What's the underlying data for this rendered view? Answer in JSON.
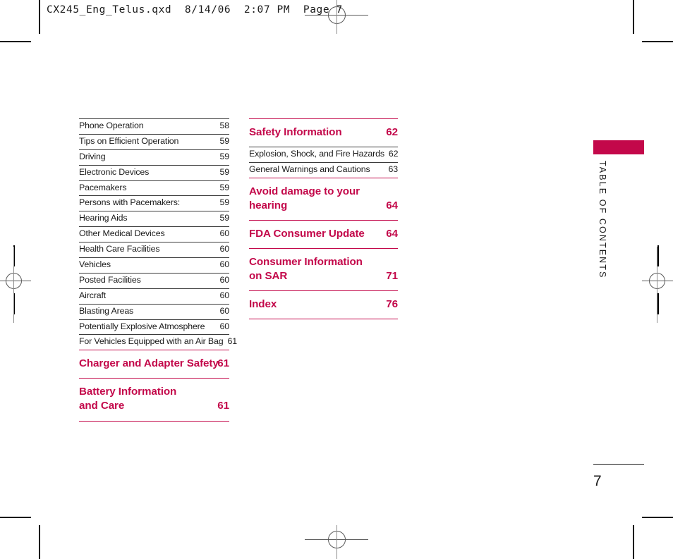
{
  "meta": {
    "slug": "CX245_Eng_Telus.qxd  8/14/06  2:07 PM  Page 7",
    "accent_color": "#c3084a",
    "rule_color": "#3b3b3b",
    "text_color": "#1a1a1a",
    "folio": "7",
    "side_tab_label": "TABLE OF CONTENTS"
  },
  "toc": {
    "left_column": [
      {
        "label": "Phone Operation",
        "page": "58",
        "kind": "sub"
      },
      {
        "label": "Tips on Efficient Operation",
        "page": "59",
        "kind": "sub"
      },
      {
        "label": "Driving",
        "page": "59",
        "kind": "sub"
      },
      {
        "label": "Electronic Devices",
        "page": "59",
        "kind": "sub"
      },
      {
        "label": "Pacemakers",
        "page": "59",
        "kind": "sub"
      },
      {
        "label": "Persons with Pacemakers:",
        "page": "59",
        "kind": "sub"
      },
      {
        "label": "Hearing Aids",
        "page": "59",
        "kind": "sub"
      },
      {
        "label": "Other Medical Devices",
        "page": "60",
        "kind": "sub"
      },
      {
        "label": "Health Care Facilities",
        "page": "60",
        "kind": "sub"
      },
      {
        "label": "Vehicles",
        "page": "60",
        "kind": "sub"
      },
      {
        "label": "Posted Facilities",
        "page": "60",
        "kind": "sub"
      },
      {
        "label": "Aircraft",
        "page": "60",
        "kind": "sub"
      },
      {
        "label": "Blasting Areas",
        "page": "60",
        "kind": "sub"
      },
      {
        "label": "Potentially Explosive Atmosphere",
        "page": "60",
        "kind": "sub"
      },
      {
        "label": "For Vehicles Equipped with an Air Bag",
        "page": "61",
        "kind": "sub"
      },
      {
        "label": "Charger and Adapter Safety",
        "page": "61",
        "kind": "head",
        "lines": 1
      },
      {
        "label": "Battery Information and Care",
        "page": "61",
        "kind": "head",
        "lines": 2
      }
    ],
    "right_column": [
      {
        "label": "Safety Information",
        "page": "62",
        "kind": "head",
        "lines": 1
      },
      {
        "label": "Explosion, Shock, and Fire Hazards",
        "page": "62",
        "kind": "sub"
      },
      {
        "label": "General Warnings and Cautions",
        "page": "63",
        "kind": "sub"
      },
      {
        "label": "Avoid damage to your hearing",
        "page": "64",
        "kind": "head",
        "lines": 2
      },
      {
        "label": "FDA Consumer Update",
        "page": "64",
        "kind": "head",
        "lines": 1
      },
      {
        "label": "Consumer Information on SAR",
        "page": "71",
        "kind": "head",
        "lines": 2
      },
      {
        "label": "Index",
        "page": "76",
        "kind": "head",
        "lines": 1
      }
    ]
  }
}
